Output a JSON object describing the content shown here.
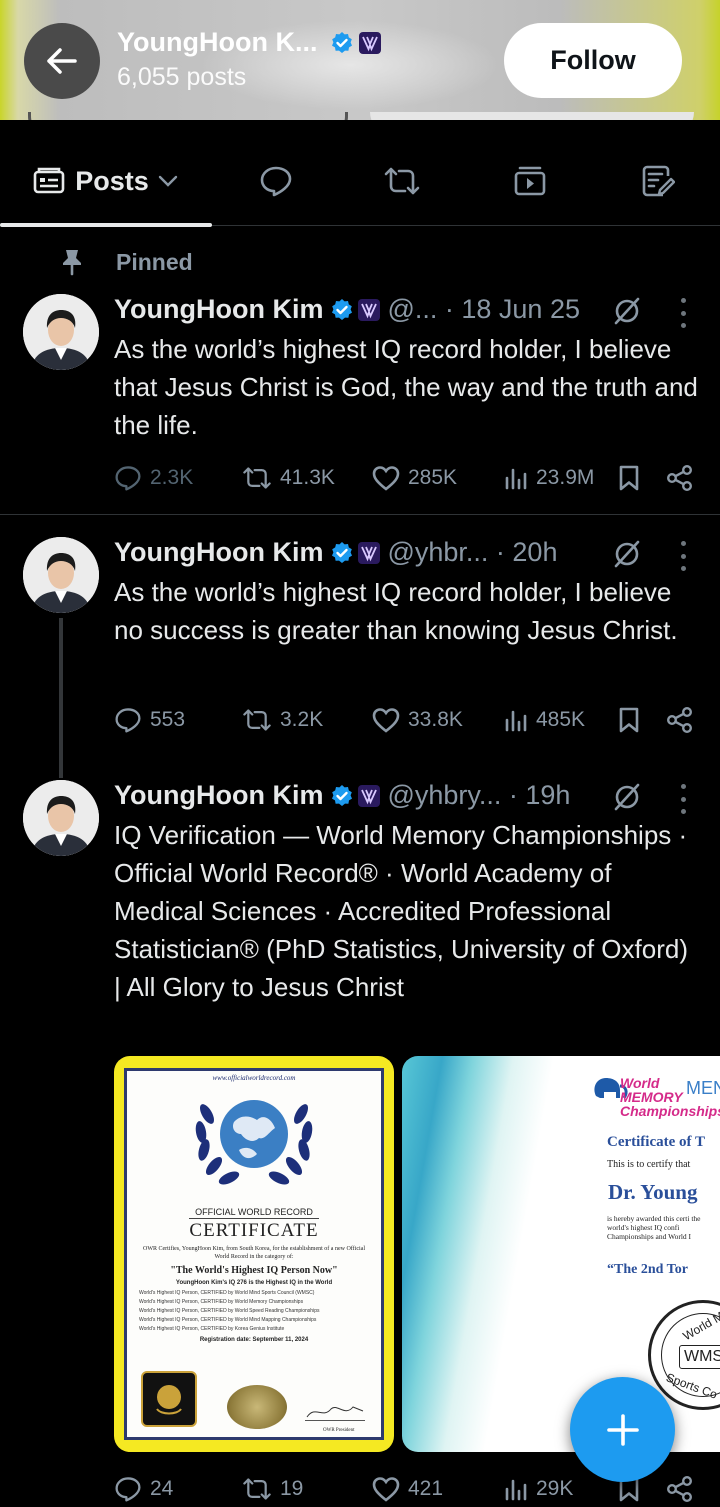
{
  "header": {
    "name": "YoungHoon K...",
    "post_count": "6,055 posts",
    "follow_label": "Follow"
  },
  "tabs": [
    {
      "label": "Posts",
      "icon": "posts-icon"
    },
    {
      "icon": "reply-icon"
    },
    {
      "icon": "retweet-icon"
    },
    {
      "icon": "media-icon"
    },
    {
      "icon": "articles-icon"
    }
  ],
  "pinned_label": "Pinned",
  "tweets": [
    {
      "name": "YoungHoon Kim",
      "meta": "@... · 18 Jun 25",
      "text": "As the world’s highest IQ record holder, I believe that Jesus Christ is God, the way and the truth and the life.",
      "replies": "2.3K",
      "retweets": "41.3K",
      "likes": "285K",
      "views": "23.9M"
    },
    {
      "name": "YoungHoon Kim",
      "meta": "@yhbr... · 20h",
      "text": "As the world’s highest IQ record holder, I believe no success is greater than knowing Jesus Christ.",
      "replies": "553",
      "retweets": "3.2K",
      "likes": "33.8K",
      "views": "485K"
    },
    {
      "name": "YoungHoon Kim",
      "meta": "@yhbry... · 19h",
      "text": "IQ Verification — World Memory Championships · Official World Record® · World Academy of Medical Sciences · Accredited Professional Statistician® (PhD Statistics, University of Oxford) | All Glory to Jesus Christ",
      "replies": "24",
      "retweets": "19",
      "likes": "421",
      "views": "29K"
    }
  ],
  "media": {
    "cert1": {
      "url": "www.officialworldrecord.com",
      "heading": "OFFICIAL WORLD RECORD",
      "title": "CERTIFICATE",
      "body": "OWR Certifies, YoungHoon Kim, from South Korea, for the establishment of a new Official World Record in the category of:",
      "record": "\"The World's Highest IQ Person Now\"",
      "sub": "YoungHoon Kim's IQ 276 is the Highest IQ in the World",
      "lines": [
        "World's Highest IQ Person, CERTIFIED by World Mind Sports Council (WMSC)",
        "World's Highest IQ Person, CERTIFIED by World Memory Championships",
        "World's Highest IQ Person, CERTIFIED by World Speed Reading Championships",
        "World's Highest IQ Person, CERTIFIED by World Mind Mapping Championships",
        "World's Highest IQ Person, CERTIFIED by Korea Genius Institute"
      ],
      "date": "Registration date: September 11, 2024",
      "signer": "OWR President"
    },
    "cert2": {
      "logo": "World MEMORY Championships",
      "corner": "MEN",
      "title": "Certificate of T",
      "line1": "This is to certify that",
      "name": "Dr. Young",
      "line2": "is hereby awarded this certi the world's highest IQ confi Championships and World I",
      "record": "“The 2nd Tor",
      "seal_top": "World M",
      "seal_mid": "WMS",
      "seal_bottom": "Sports Co"
    }
  },
  "colors": {
    "background": "#000000",
    "text": "#e7e9ea",
    "muted": "#8b98a5",
    "accent": "#1d9bf0",
    "divider": "#2f3336"
  }
}
